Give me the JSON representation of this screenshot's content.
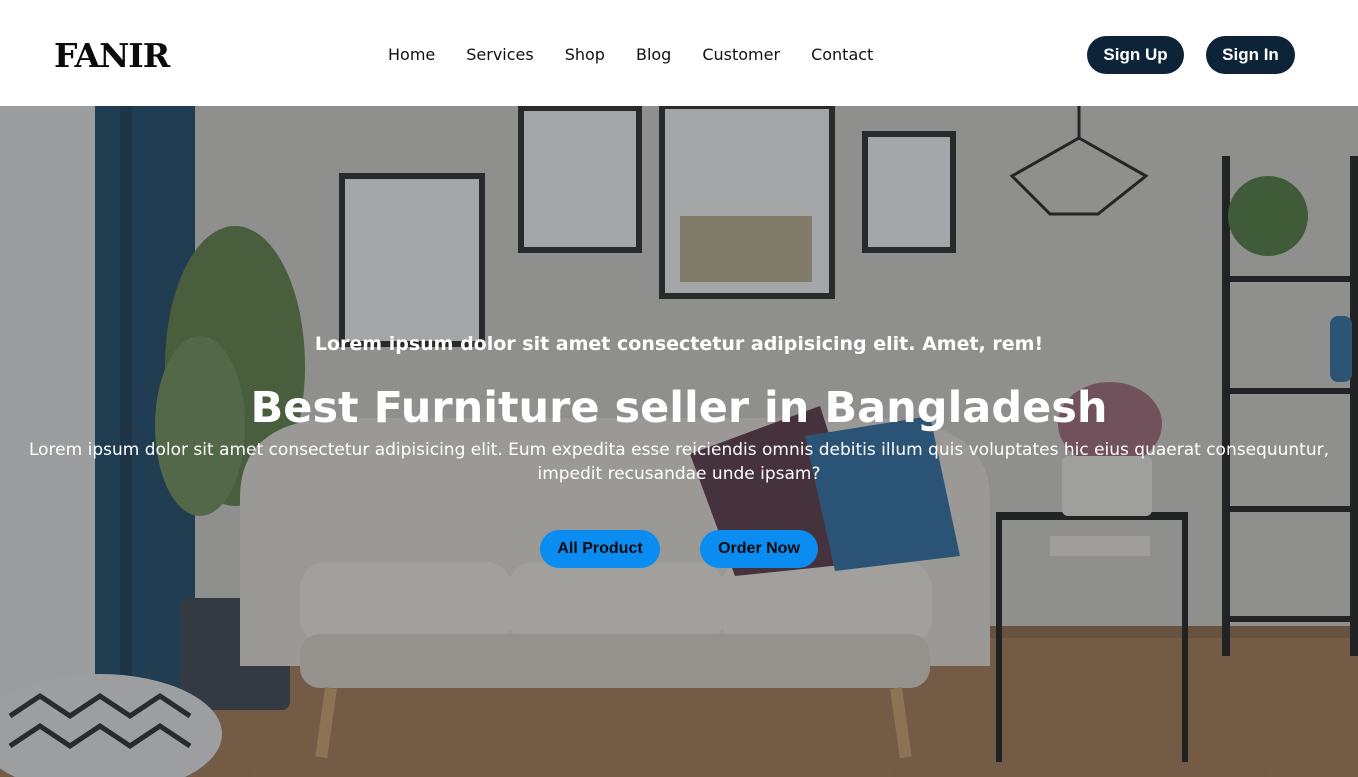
{
  "brand": {
    "logo": "FANIR"
  },
  "nav": {
    "items": [
      {
        "label": "Home"
      },
      {
        "label": "Services"
      },
      {
        "label": "Shop"
      },
      {
        "label": "Blog"
      },
      {
        "label": "Customer"
      },
      {
        "label": "Contact"
      }
    ]
  },
  "auth": {
    "signup_label": "Sign Up",
    "signin_label": "Sign In"
  },
  "hero": {
    "tagline": "Lorem ipsum dolor sit amet consectetur adipisicing elit. Amet, rem!",
    "title": "Best Furniture seller in Bangladesh",
    "description": "Lorem ipsum dolor sit amet consectetur adipisicing elit. Eum expedita esse reiciendis omnis debitis illum quis voluptates hic eius quaerat consequuntur, impedit recusandae unde ipsam?",
    "buttons": {
      "all_product": "All Product",
      "order_now": "Order Now"
    }
  },
  "colors": {
    "header_bg": "#ffffff",
    "auth_button_bg": "#0d2438",
    "cta_button_bg": "#0b8cf0",
    "hero_text": "#ffffff"
  }
}
